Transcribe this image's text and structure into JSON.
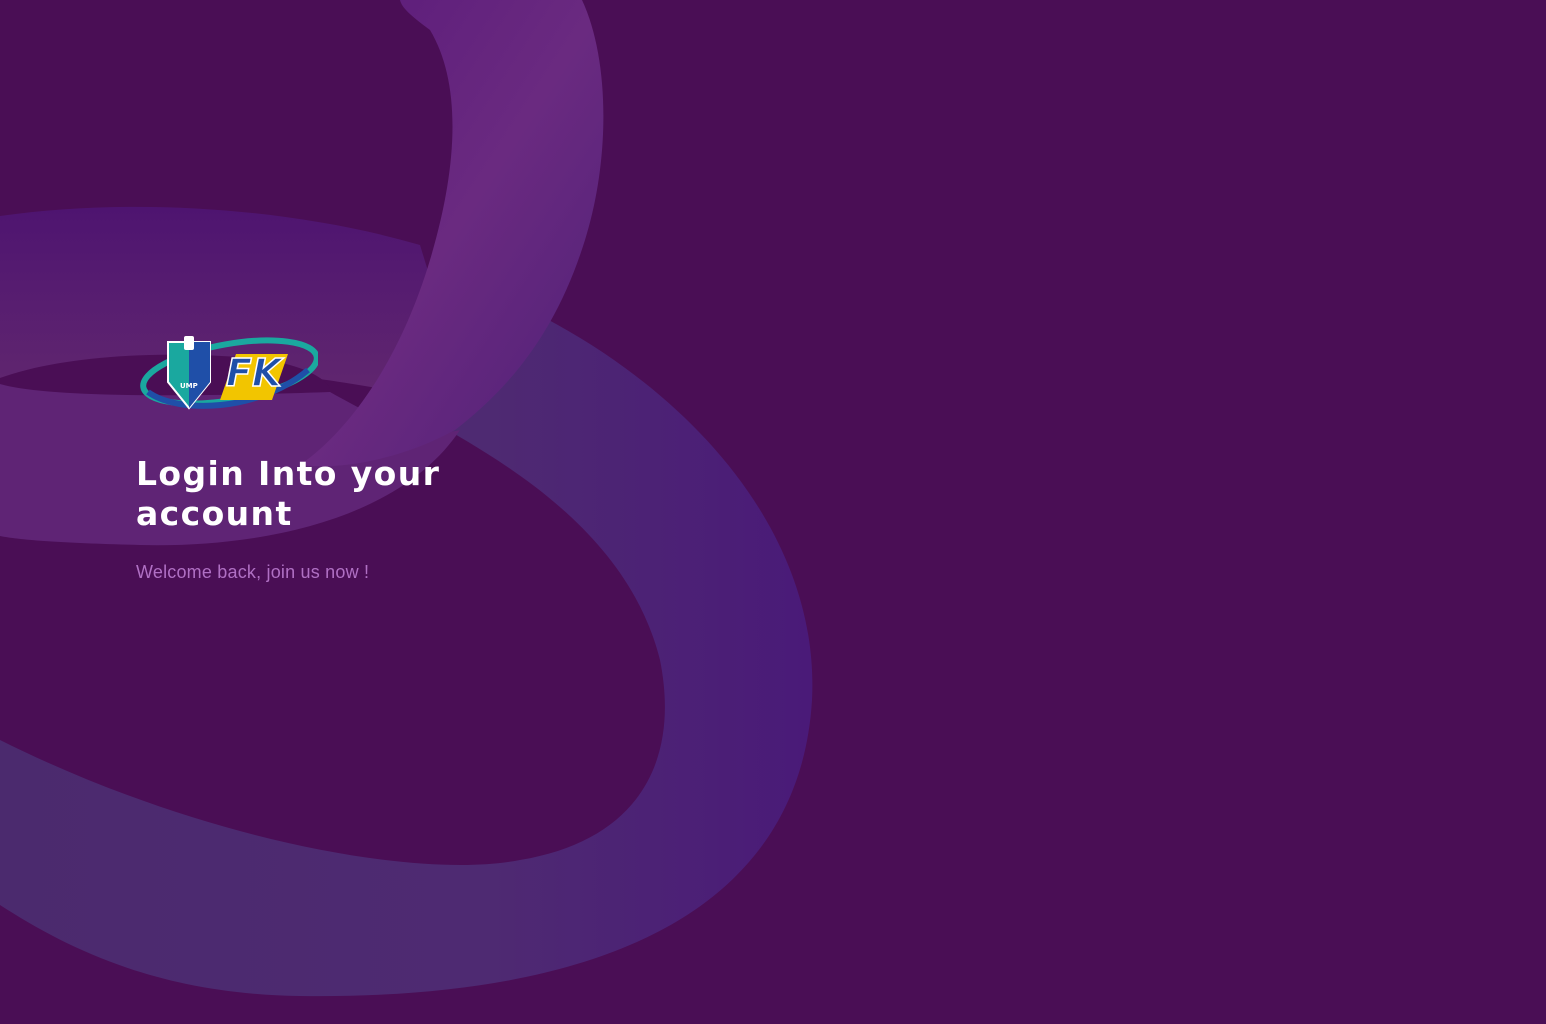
{
  "logo": {
    "mark_text": "FK",
    "badge_text": "UMP"
  },
  "login": {
    "title": "Login Into your account",
    "subtitle": "Welcome back, join us now !"
  },
  "colors": {
    "background": "#4a0e55",
    "swirl_light": "#7a3a86",
    "swirl_blue": "#4d1a76",
    "subtitle": "#b070c4",
    "logo_teal": "#1aa89f",
    "logo_blue": "#1f4fa8",
    "logo_yellow": "#f2c500"
  }
}
